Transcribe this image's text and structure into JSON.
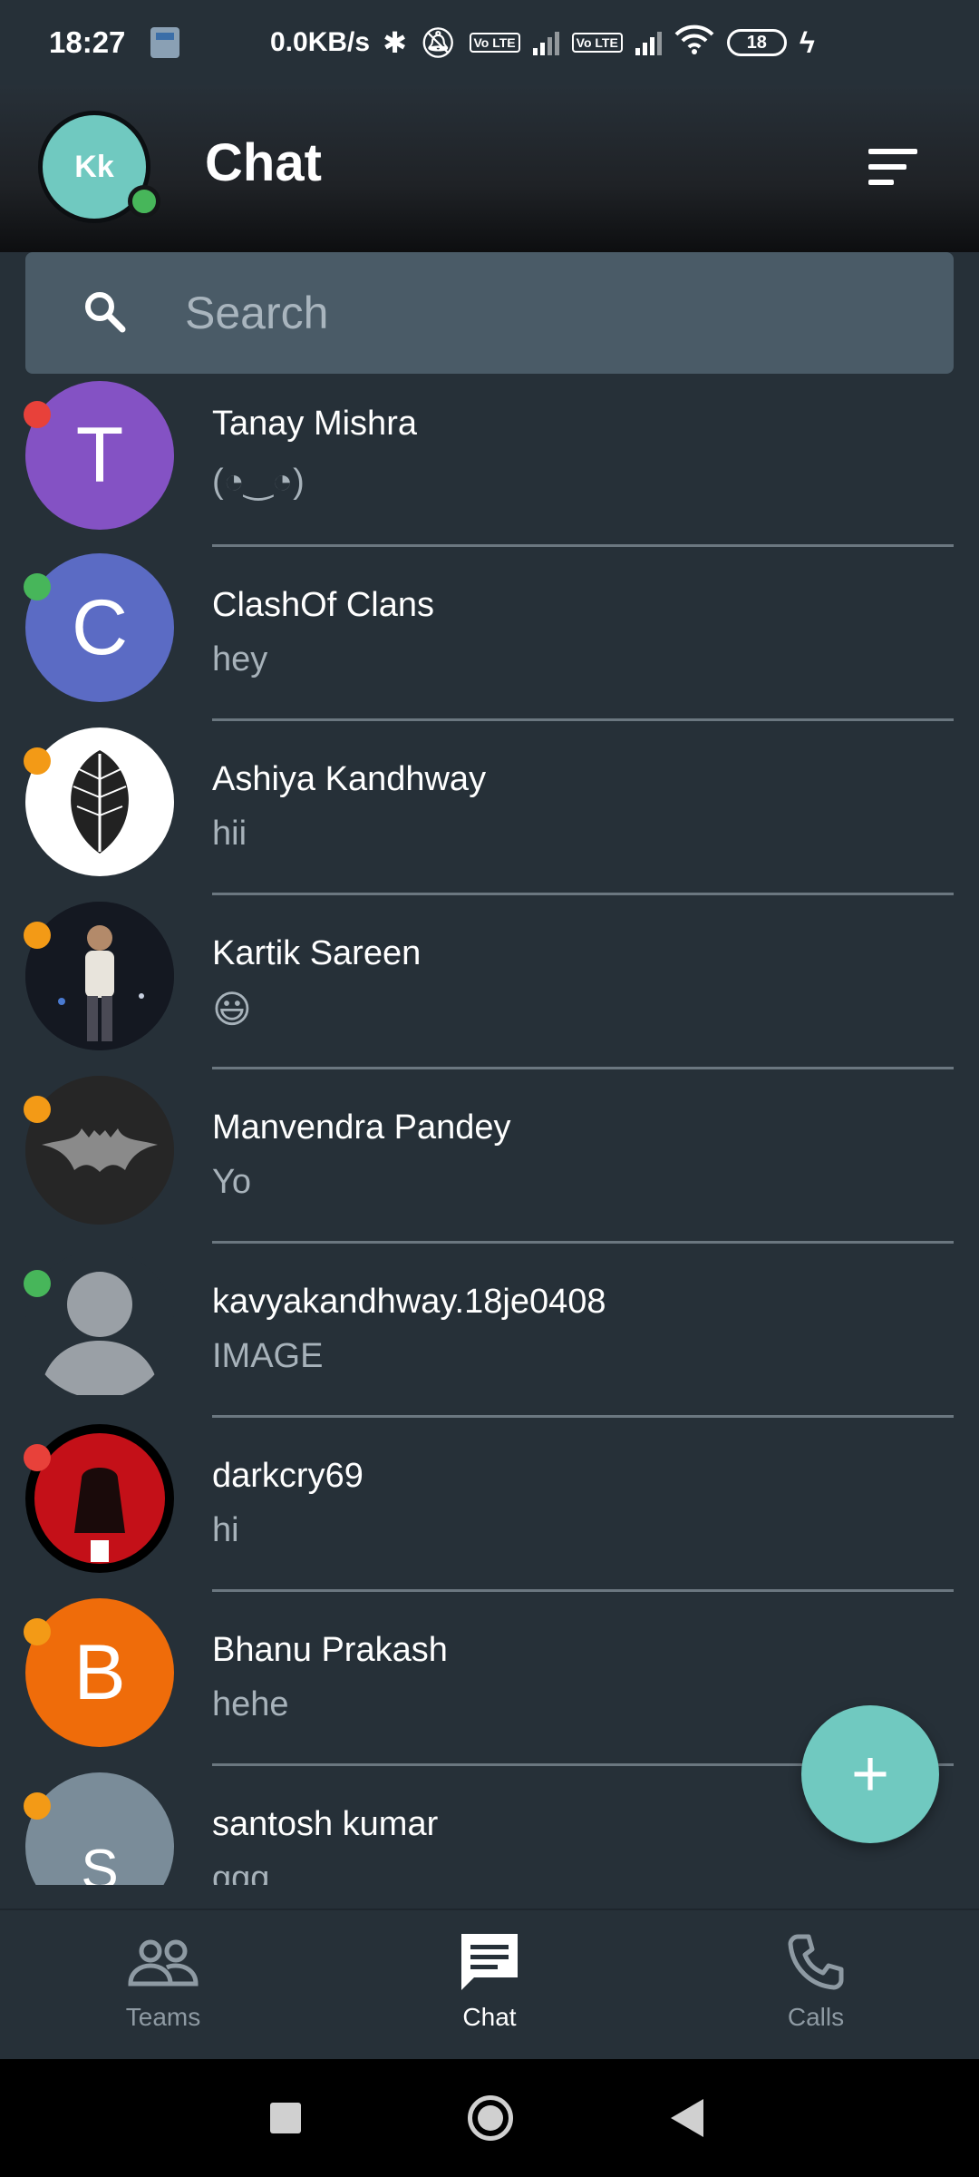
{
  "status_bar": {
    "time": "18:27",
    "network_speed": "0.0KB/s",
    "lte1": "Vo LTE",
    "lte2": "Vo LTE",
    "battery": "18"
  },
  "header": {
    "avatar_initials": "Kk",
    "title": "Chat"
  },
  "search": {
    "placeholder": "Search"
  },
  "colors": {
    "accent": "#70c9c0",
    "online": "#47b65a",
    "busy": "#e8413a",
    "away": "#f39a16"
  },
  "chats": [
    {
      "name": "Tanay Mishra",
      "message": "(◔‿◔)",
      "avatar_letter": "T",
      "avatar_color": "#8452c4",
      "status": "busy"
    },
    {
      "name": "ClashOf Clans",
      "message": "hey",
      "avatar_letter": "C",
      "avatar_color": "#5b6bc4",
      "status": "online"
    },
    {
      "name": "Ashiya Kandhway",
      "message": "hii",
      "avatar_letter": "",
      "avatar_color": "#ffffff",
      "avatar_icon": "leaf-sketch-photo",
      "status": "away"
    },
    {
      "name": "Kartik Sareen",
      "message": "😃",
      "avatar_letter": "",
      "avatar_color": "#161a24",
      "avatar_icon": "person-photo",
      "status": "away"
    },
    {
      "name": "Manvendra Pandey",
      "message": "Yo",
      "avatar_letter": "",
      "avatar_color": "#2a2a2a",
      "avatar_icon": "bat-logo-photo",
      "status": "away"
    },
    {
      "name": "kavyakandhway.18je0408",
      "message": "IMAGE",
      "avatar_letter": "",
      "avatar_color": "#263038",
      "avatar_icon": "default-person-icon",
      "status": "online"
    },
    {
      "name": "darkcry69",
      "message": "hi",
      "avatar_letter": "",
      "avatar_color": "#c41018",
      "avatar_icon": "dark-figure-photo",
      "status": "busy"
    },
    {
      "name": "Bhanu Prakash",
      "message": "hehe",
      "avatar_letter": "B",
      "avatar_color": "#ef6c0a",
      "status": "away"
    },
    {
      "name": "santosh kumar",
      "message": "ggg",
      "avatar_letter": "S",
      "avatar_color": "#7a8c99",
      "status": "away"
    }
  ],
  "fab": {
    "label": "+"
  },
  "bottom_nav": {
    "items": [
      {
        "label": "Teams",
        "icon": "teams-icon",
        "active": false
      },
      {
        "label": "Chat",
        "icon": "chat-icon",
        "active": true
      },
      {
        "label": "Calls",
        "icon": "phone-icon",
        "active": false
      }
    ]
  }
}
